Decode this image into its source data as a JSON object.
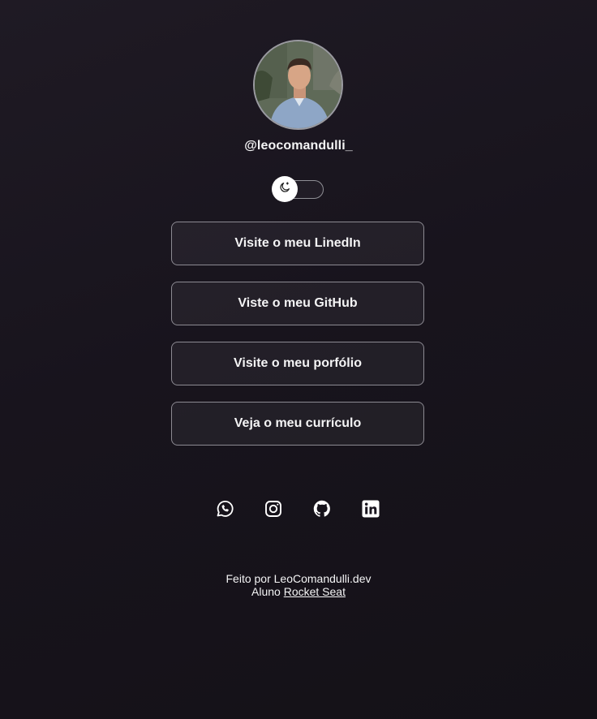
{
  "profile": {
    "username": "@leocomandulli_"
  },
  "theme_toggle": {
    "icon": "moon-icon"
  },
  "links": [
    {
      "label": "Visite o meu LinedIn"
    },
    {
      "label": "Viste o meu GitHub"
    },
    {
      "label": "Visite o meu porfólio"
    },
    {
      "label": "Veja o meu currículo"
    }
  ],
  "socials": [
    {
      "icon": "whatsapp-icon"
    },
    {
      "icon": "instagram-icon"
    },
    {
      "icon": "github-icon"
    },
    {
      "icon": "linkedin-icon"
    }
  ],
  "footer": {
    "made_by": "Feito por LeoComandulli.dev",
    "student_prefix": "Aluno",
    "school_link": "Rocket Seat"
  },
  "colors": {
    "background": "#1a161f",
    "text": "#f4f4f5",
    "button_border": "#8c8a92"
  }
}
